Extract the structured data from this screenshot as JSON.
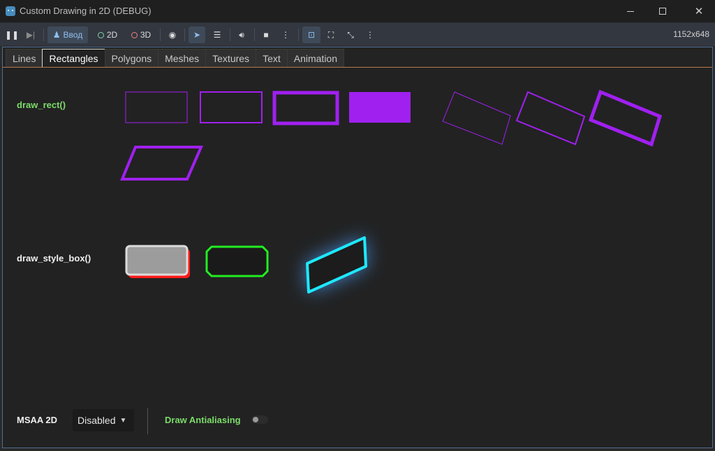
{
  "window": {
    "title": "Custom Drawing in 2D (DEBUG)"
  },
  "toolbar": {
    "input_label": "Ввод",
    "mode_2d_label": "2D",
    "mode_3d_label": "3D",
    "resolution": "1152x648"
  },
  "tabs": [
    {
      "label": "Lines"
    },
    {
      "label": "Rectangles"
    },
    {
      "label": "Polygons"
    },
    {
      "label": "Meshes"
    },
    {
      "label": "Textures"
    },
    {
      "label": "Text"
    },
    {
      "label": "Animation"
    }
  ],
  "selected_tab": "Rectangles",
  "sections": {
    "draw_rect": {
      "label": "draw_rect()"
    },
    "draw_style_box": {
      "label": "draw_style_box()"
    }
  },
  "controls": {
    "msaa_label": "MSAA 2D",
    "msaa_value": "Disabled",
    "antialiasing_label": "Draw Antialiasing",
    "antialiasing_enabled": false
  },
  "colors": {
    "purple": "#a020f0",
    "green_label": "#7cdc6a",
    "accent_blue": "#478cbf",
    "stylebox_gray": "#9c9c9c",
    "stylebox_shadow": "#ff1a1a",
    "stylebox_green": "#22ee22",
    "stylebox_cyan": "#1ee8ff",
    "glow": "#4aa0ff"
  }
}
